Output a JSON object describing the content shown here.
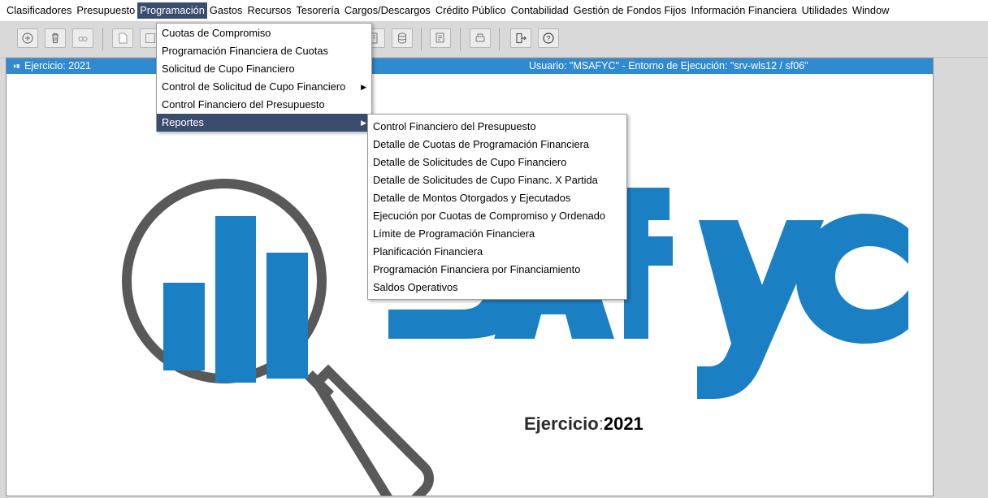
{
  "menubar": {
    "items": [
      {
        "label": "Clasificadores",
        "mnemonic": "C"
      },
      {
        "label": "Presupuesto",
        "mnemonic": "P"
      },
      {
        "label": "Programación",
        "mnemonic": "P",
        "active": true
      },
      {
        "label": "Gastos",
        "mnemonic": "G"
      },
      {
        "label": "Recursos",
        "mnemonic": "R"
      },
      {
        "label": "Tesorería",
        "mnemonic": "T"
      },
      {
        "label": "Cargos/Descargos",
        "mnemonic": "C"
      },
      {
        "label": "Crédito Público",
        "mnemonic": "l"
      },
      {
        "label": "Contabilidad",
        "mnemonic": "C"
      },
      {
        "label": "Gestión de Fondos Fijos",
        "mnemonic": "G"
      },
      {
        "label": "Información Financiera",
        "mnemonic": "I"
      },
      {
        "label": "Utilidades",
        "mnemonic": "U"
      },
      {
        "label": "Window",
        "mnemonic": "W"
      }
    ]
  },
  "toolbar": {
    "buttons": [
      "add-icon",
      "delete-icon",
      "link-icon",
      "new-document-icon",
      "save-icon",
      "query-icon",
      "database-icon",
      "report-icon",
      "print-icon",
      "exit-icon",
      "help-icon"
    ]
  },
  "window": {
    "title": "Ejercicio: 2021",
    "status": "Usuario: \"MSAFYC\"  -   Entorno de Ejecución: \"srv-wls12 / sf06\""
  },
  "logo": {
    "text": "SAFyC",
    "brand_color": "#1b7fc4",
    "magnifier_color": "#595959"
  },
  "ejercicio": {
    "label": "Ejercicio",
    "separator": ":",
    "year": "2021"
  },
  "programacion_menu": {
    "items": [
      {
        "label": "Cuotas de Compromiso",
        "submenu": false
      },
      {
        "label": "Programación Financiera de Cuotas",
        "submenu": false
      },
      {
        "label": "Solicitud de Cupo Financiero",
        "submenu": false
      },
      {
        "label": "Control de Solicitud de Cupo Financiero",
        "submenu": true
      },
      {
        "label": "Control Financiero del Presupuesto",
        "submenu": false
      },
      {
        "label": "Reportes",
        "submenu": true,
        "highlighted": true
      }
    ]
  },
  "reportes_menu": {
    "items": [
      "Control Financiero del Presupuesto",
      "Detalle de Cuotas de Programación Financiera",
      "Detalle de Solicitudes de Cupo Financiero",
      "Detalle de Solicitudes de Cupo Financ. X Partida",
      "Detalle de Montos Otorgados y Ejecutados",
      "Ejecución por Cuotas de Compromiso y Ordenado",
      "Límite de Programación Financiera",
      "Planificación Financiera",
      "Programación Financiera por Financiamiento",
      "Saldos Operativos"
    ]
  }
}
